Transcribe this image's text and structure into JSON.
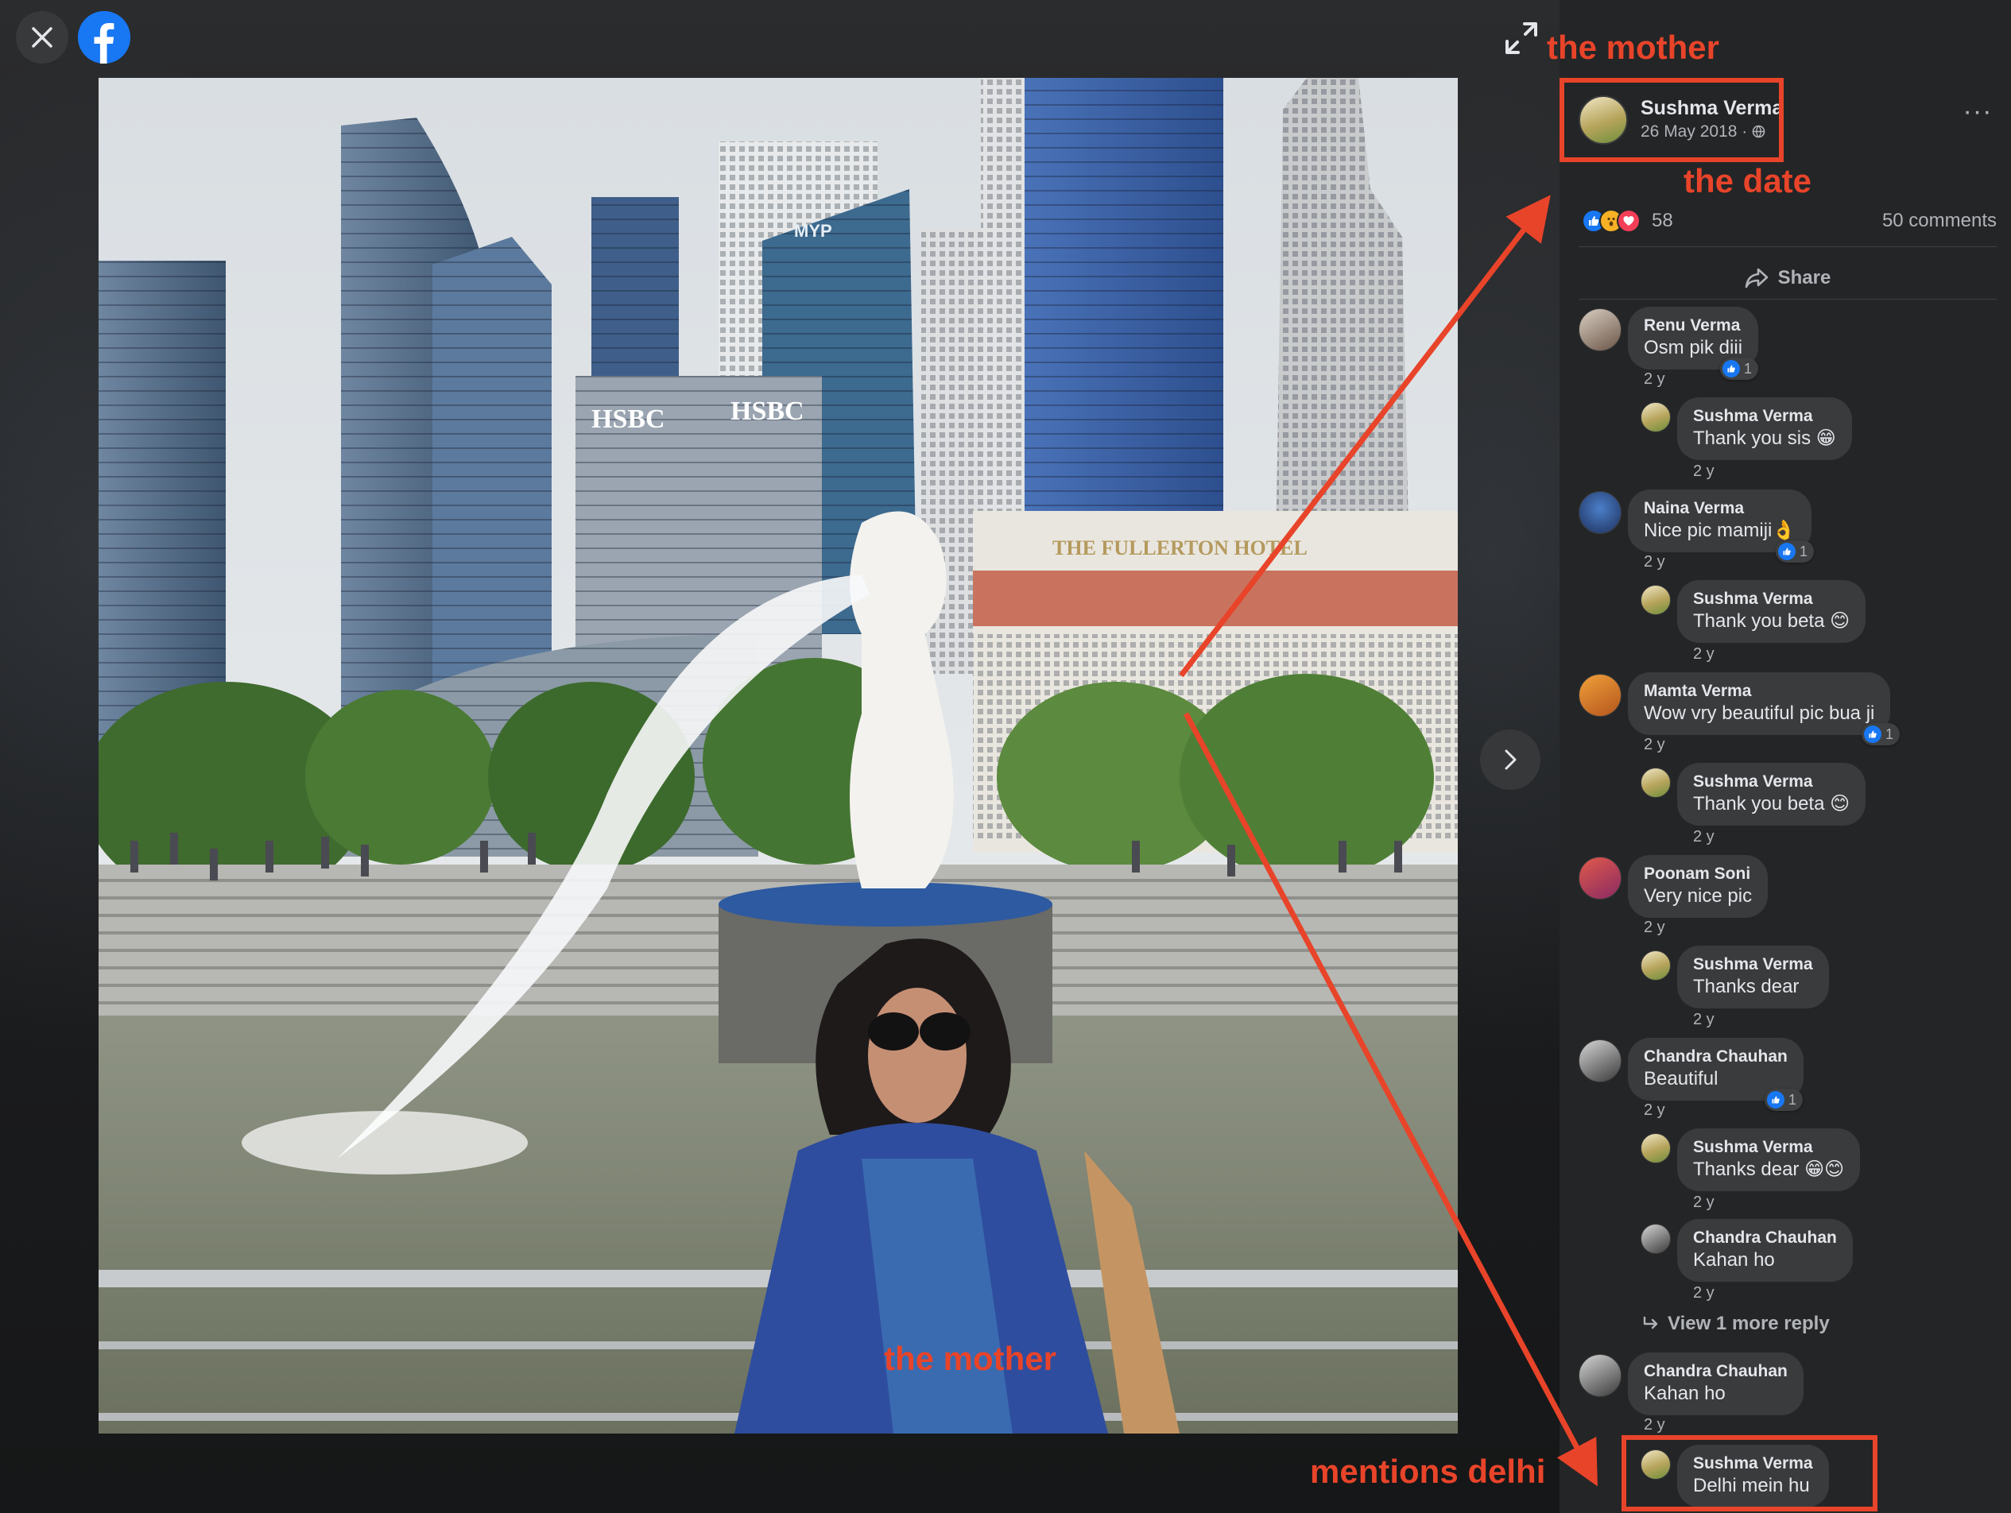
{
  "annotations": {
    "mother_top": "the mother",
    "date": "the date",
    "mother_photo": "the mother",
    "delhi": "mentions delhi"
  },
  "colors": {
    "annotation": "#e8442a",
    "background": "#18191a",
    "panel": "#242526",
    "bubble": "#3a3b3c",
    "accent": "#1877f2"
  },
  "icons": {
    "close": "close-icon",
    "logo": "facebook-logo-icon",
    "expand": "expand-icon",
    "next": "chevron-right-icon",
    "create": "plus-icon",
    "messenger": "messenger-icon",
    "notifications": "bell-icon",
    "account": "caret-down-icon",
    "share": "share-arrow-icon",
    "privacy": "globe-icon"
  },
  "post": {
    "author": "Sushma Verma",
    "date": "26 May 2018 · ",
    "reactions_count": "58",
    "comments_count": "50 comments",
    "share_label": "Share",
    "more": "···"
  },
  "comments": [
    {
      "name": "Renu Verma",
      "text": "Osm pik diii",
      "time": "2 y",
      "likes": "1"
    },
    {
      "name": "Sushma Verma",
      "text": "Thank you sis 😁",
      "time": "2 y"
    },
    {
      "name": "Naina Verma",
      "text": "Nice pic mamiji👌",
      "time": "2 y",
      "likes": "1"
    },
    {
      "name": "Sushma Verma",
      "text": "Thank you beta 😊",
      "time": "2 y"
    },
    {
      "name": "Mamta Verma",
      "text": "Wow vry beautiful pic bua ji",
      "time": "2 y",
      "likes": "1"
    },
    {
      "name": "Sushma Verma",
      "text": "Thank you beta 😊",
      "time": "2 y"
    },
    {
      "name": "Poonam Soni",
      "text": "Very nice pic",
      "time": "2 y"
    },
    {
      "name": "Sushma Verma",
      "text": "Thanks dear",
      "time": "2 y"
    },
    {
      "name": "Chandra Chauhan",
      "text": "Beautiful",
      "time": "2 y",
      "likes": "1"
    },
    {
      "name": "Sushma Verma",
      "text": "Thanks dear 😁😊",
      "time": "2 y"
    },
    {
      "name": "Chandra Chauhan",
      "text": "Kahan ho",
      "time": "2 y"
    },
    {
      "name": "Chandra Chauhan",
      "text": "Kahan ho",
      "time": "2 y"
    },
    {
      "name": "Sushma Verma",
      "text": "Delhi mein hu"
    }
  ],
  "view_more": "View 1 more reply",
  "photo_signage": {
    "hsbc_1": "HSBC",
    "hsbc_2": "HSBC",
    "hotel": "THE FULLERTON HOTEL",
    "myp": "MYP"
  }
}
